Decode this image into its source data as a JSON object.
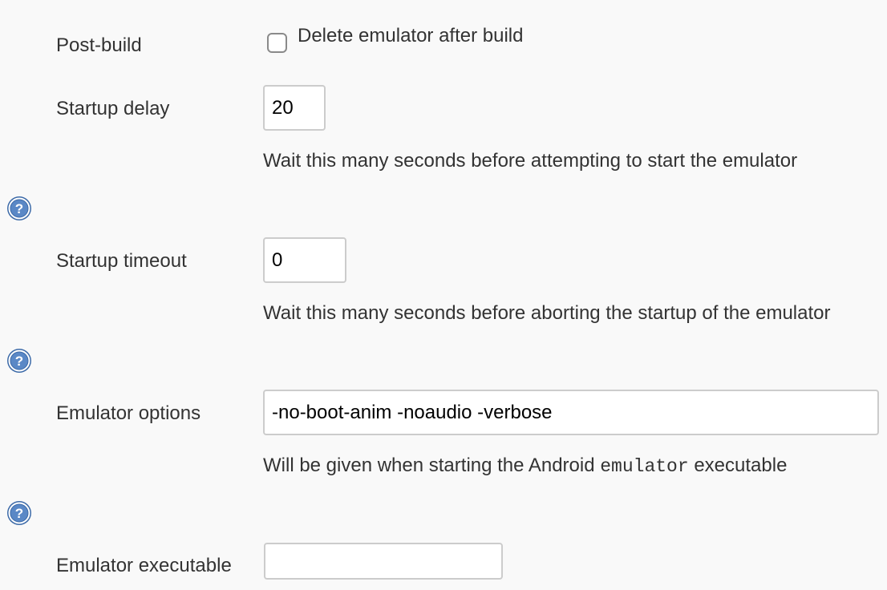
{
  "post_build": {
    "label": "Post-build",
    "checkbox_label": "Delete emulator after build",
    "checked": false
  },
  "startup_delay": {
    "label": "Startup delay",
    "value": "20",
    "description": "Wait this many seconds before attempting to start the emulator"
  },
  "startup_timeout": {
    "label": "Startup timeout",
    "value": "0",
    "description": "Wait this many seconds before aborting the startup of the emulator"
  },
  "emulator_options": {
    "label": "Emulator options",
    "value": "-no-boot-anim -noaudio -verbose",
    "description_before": "Will be given when starting the Android ",
    "description_code": "emulator",
    "description_after": " executable"
  },
  "emulator_executable": {
    "label": "Emulator executable",
    "value": ""
  },
  "icons": {
    "help": "help-icon"
  },
  "colors": {
    "background": "#f9f9f9",
    "text": "#333333",
    "input_border": "#cccccc",
    "help_icon": "#3c6aa8"
  }
}
